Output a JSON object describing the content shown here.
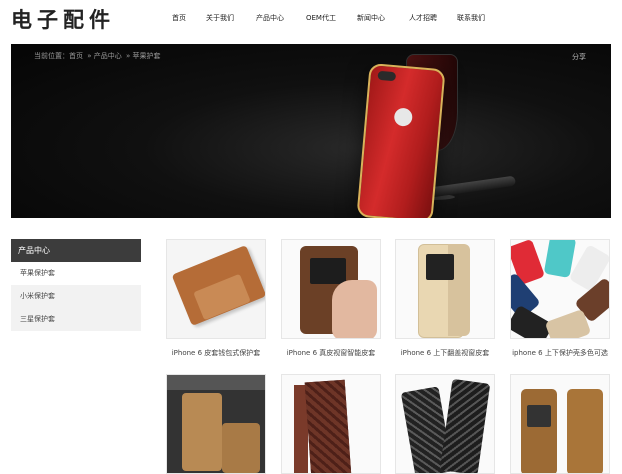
{
  "site": {
    "logo": "电子配件",
    "nav": [
      "首页",
      "关于我们",
      "产品中心",
      "OEM代工",
      "新闻中心",
      "人才招聘",
      "联系我们"
    ]
  },
  "banner": {
    "breadcrumb": [
      "当前位置：首页",
      "产品中心",
      "苹果护套"
    ],
    "share_label": "分享"
  },
  "sidebar": {
    "title": "产品中心",
    "items": [
      "苹果保护套",
      "小米保护套",
      "三星保护套"
    ]
  },
  "products": [
    {
      "caption": "iPhone 6 皮套钱包式保护套"
    },
    {
      "caption": "iPhone 6 真皮视窗智能皮套"
    },
    {
      "caption": "iPhone 6 上下翻盖视窗皮套"
    },
    {
      "caption": "iphone 6 上下保护壳多色可选"
    },
    {
      "caption": ""
    },
    {
      "caption": ""
    },
    {
      "caption": ""
    },
    {
      "caption": ""
    }
  ]
}
